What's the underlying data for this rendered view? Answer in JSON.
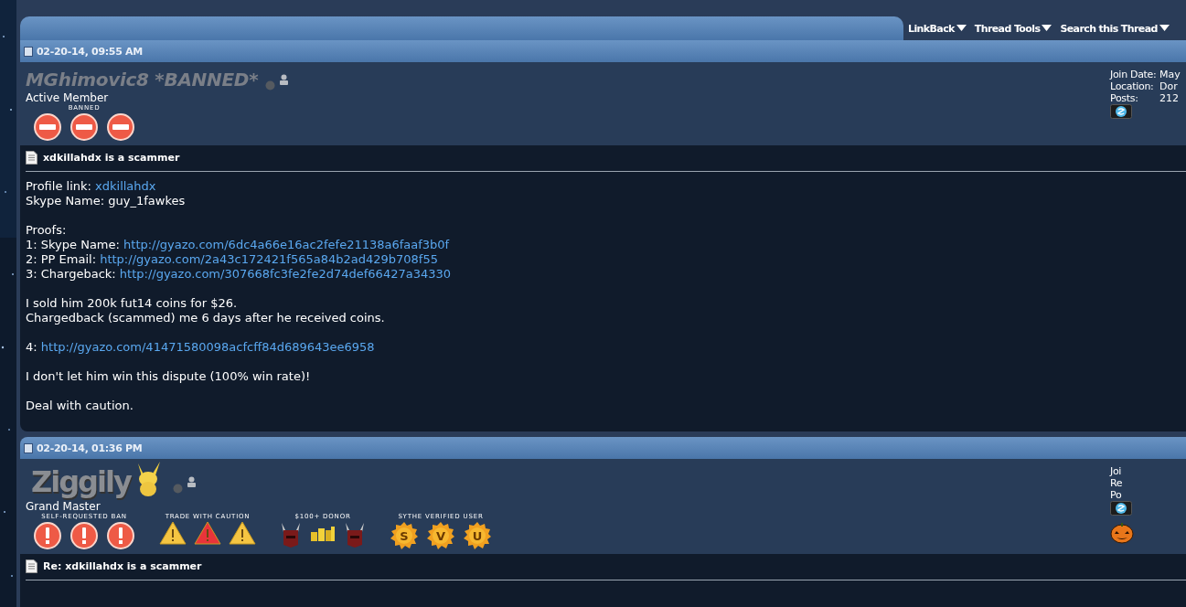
{
  "thread_tools": [
    {
      "label": "LinkBack"
    },
    {
      "label": "Thread Tools"
    },
    {
      "label": "Search this Thread"
    }
  ],
  "posts": [
    {
      "date": "02-20-14, 09:55 AM",
      "username": {
        "text": "MGhimovic8 *BANNED*",
        "kind": "text"
      },
      "rank": "Active Member",
      "badge_groups": [
        {
          "label": "BANNED",
          "badges": [
            {
              "kind": "ban"
            },
            {
              "kind": "ban"
            },
            {
              "kind": "ban"
            }
          ]
        }
      ],
      "info": [
        {
          "label": "Join Date:",
          "value": "May"
        },
        {
          "label": "Location:",
          "value": "Dor"
        },
        {
          "label": "Posts:",
          "value": "212"
        }
      ],
      "title": "xdkillahdx is a scammer",
      "paragraphs": [
        {
          "lines": [
            {
              "segments": [
                {
                  "text": "Profile link: "
                },
                {
                  "text": "xdkillahdx",
                  "link": true
                }
              ]
            },
            {
              "segments": [
                {
                  "text": "Skype Name: guy_1fawkes"
                }
              ]
            }
          ]
        },
        {
          "lines": [
            {
              "segments": [
                {
                  "text": "Proofs:"
                }
              ]
            },
            {
              "segments": [
                {
                  "text": "1: Skype Name: "
                },
                {
                  "text": "http://gyazo.com/6dc4a66e16ac2fefe21138a6faaf3b0f",
                  "link": true
                }
              ]
            },
            {
              "segments": [
                {
                  "text": "2: PP Email: "
                },
                {
                  "text": "http://gyazo.com/2a43c172421f565a84b2ad429b708f55",
                  "link": true
                }
              ]
            },
            {
              "segments": [
                {
                  "text": "3: Chargeback: "
                },
                {
                  "text": "http://gyazo.com/307668fc3fe2fe2d74def66427a34330",
                  "link": true
                }
              ]
            }
          ]
        },
        {
          "lines": [
            {
              "segments": [
                {
                  "text": "I sold him 200k fut14 coins for $26."
                }
              ]
            },
            {
              "segments": [
                {
                  "text": "Chargedback (scammed) me 6 days after he received coins."
                }
              ]
            }
          ]
        },
        {
          "lines": [
            {
              "segments": [
                {
                  "text": "4: "
                },
                {
                  "text": "http://gyazo.com/41471580098acfcff84d689643ee6958",
                  "link": true
                }
              ]
            }
          ]
        },
        {
          "lines": [
            {
              "segments": [
                {
                  "text": "I don't let him win this dispute (100% win rate)!"
                }
              ]
            }
          ]
        },
        {
          "lines": [
            {
              "segments": [
                {
                  "text": "Deal with caution."
                }
              ]
            }
          ]
        }
      ]
    },
    {
      "date": "02-20-14, 01:36 PM",
      "username": {
        "text": "Ziggily",
        "kind": "logo"
      },
      "rank": "Grand Master",
      "badge_groups": [
        {
          "label": "SELF-REQUESTED BAN",
          "badges": [
            {
              "kind": "alert"
            },
            {
              "kind": "alert"
            },
            {
              "kind": "alert"
            }
          ]
        },
        {
          "label": "TRADE WITH CAUTION",
          "badges": [
            {
              "kind": "warning",
              "color": "#f5c542"
            },
            {
              "kind": "warning",
              "color": "#e8343a"
            },
            {
              "kind": "warning",
              "color": "#f5c542"
            }
          ]
        },
        {
          "label": "$100+ DONOR",
          "badges": [
            {
              "kind": "helm"
            },
            {
              "kind": "coins"
            },
            {
              "kind": "helm"
            }
          ]
        },
        {
          "label": "SYTHE VERIFIED USER",
          "badges": [
            {
              "kind": "seal",
              "letter": "S"
            },
            {
              "kind": "seal",
              "letter": "V"
            },
            {
              "kind": "seal",
              "letter": "U"
            }
          ]
        }
      ],
      "info": [
        {
          "label": "Joi"
        },
        {
          "label": "Re"
        },
        {
          "label": "Po"
        }
      ],
      "extra_icons": [
        {
          "kind": "pumpkin"
        }
      ],
      "title": "Re: xdkillahdx is a scammer"
    }
  ]
}
